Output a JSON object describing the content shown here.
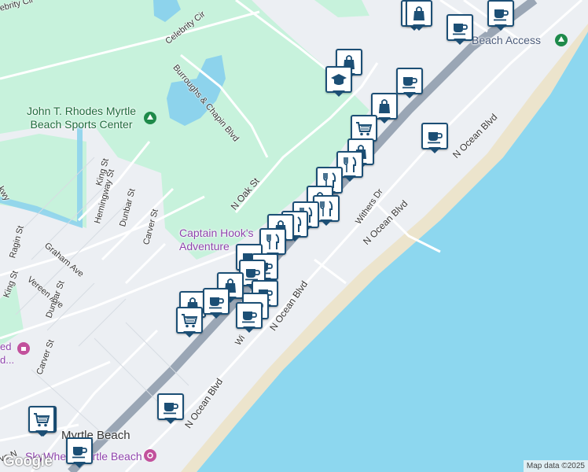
{
  "map": {
    "colors": {
      "land": "#eceff3",
      "park": "#c7f2dc",
      "water": "#8dd3ec",
      "ocean": "#8dd7ef",
      "sand": "#ece4cc",
      "road": "#ffffff",
      "highway": "#9aa6b5",
      "pin_border": "#1c4f75",
      "pin_icon": "#1c4f75"
    },
    "labels": {
      "sports_center": "John T. Rhodes Myrtle\nBeach Sports Center",
      "captain_hook": "Captain Hook's\nAdventure",
      "city": "Myrtle Beach",
      "skywheel": "SkyWheel Myrtle Beach",
      "beach_access": "Beach Access",
      "museum_partial": "ed\nd..."
    },
    "streets": {
      "celebrity_cir_top": "ebrity Cir",
      "celebrity_cir": "Celebrity Cir",
      "burroughs": "Burroughs & Chapin Blvd",
      "n_oak": "N Oak St",
      "king_st_top": "King St",
      "hemingway": "Hemingway St",
      "dunbar_top": "Dunbar St",
      "carver_top": "Carver St",
      "ragin": "Ragin St",
      "graham": "Graham Ave",
      "vereen": "Vereen Ave",
      "king_st_bottom": "King St",
      "dunbar_bottom": "Dunbar St",
      "carver_bottom": "Carver St",
      "kwy": "kwy",
      "withers": "Withers Dr",
      "ocean_1": "N Ocean Blvd",
      "ocean_2": "N Ocean Blvd",
      "ocean_3": "N Ocean Blvd",
      "ocean_4": "N Ocean Blvd",
      "wi": "Wi",
      "ve_n": "ve N"
    },
    "pins": [
      {
        "icon": "school-icon",
        "label": "school"
      },
      {
        "icon": "store-icon",
        "label": "store"
      },
      {
        "icon": "cafe-icon",
        "label": "cafe"
      },
      {
        "icon": "store-icon",
        "label": "store"
      },
      {
        "icon": "school-icon",
        "label": "school"
      },
      {
        "icon": "cafe-icon",
        "label": "cafe"
      },
      {
        "icon": "cafe-icon",
        "label": "cafe"
      },
      {
        "icon": "store-icon",
        "label": "store"
      },
      {
        "icon": "shopping-cart-icon",
        "label": "grocery"
      },
      {
        "icon": "cafe-icon",
        "label": "cafe"
      },
      {
        "icon": "store-icon",
        "label": "store"
      },
      {
        "icon": "restaurant-icon",
        "label": "restaurant"
      },
      {
        "icon": "restaurant-icon",
        "label": "restaurant"
      },
      {
        "icon": "store-icon",
        "label": "store"
      },
      {
        "icon": "restaurant-icon",
        "label": "restaurant"
      },
      {
        "icon": "restaurant-icon",
        "label": "restaurant"
      },
      {
        "icon": "restaurant-icon",
        "label": "restaurant"
      },
      {
        "icon": "store-icon",
        "label": "store"
      },
      {
        "icon": "restaurant-icon",
        "label": "restaurant"
      },
      {
        "icon": "cafe-icon",
        "label": "cafe"
      },
      {
        "icon": "cafe-icon",
        "label": "cafe"
      },
      {
        "icon": "cafe-icon",
        "label": "cafe"
      },
      {
        "icon": "store-icon",
        "label": "store"
      },
      {
        "icon": "cafe-icon",
        "label": "cafe"
      },
      {
        "icon": "cafe-icon",
        "label": "cafe"
      },
      {
        "icon": "store-icon",
        "label": "store"
      },
      {
        "icon": "cafe-icon",
        "label": "cafe"
      },
      {
        "icon": "shopping-cart-icon",
        "label": "grocery"
      },
      {
        "icon": "cafe-icon",
        "label": "cafe"
      },
      {
        "icon": "cafe-icon",
        "label": "cafe"
      },
      {
        "icon": "cafe-icon",
        "label": "cafe"
      },
      {
        "icon": "shopping-cart-icon",
        "label": "grocery"
      },
      {
        "icon": "cafe-icon",
        "label": "cafe"
      }
    ],
    "footer": {
      "google": "Google",
      "attribution": "Map data ©2025"
    }
  }
}
